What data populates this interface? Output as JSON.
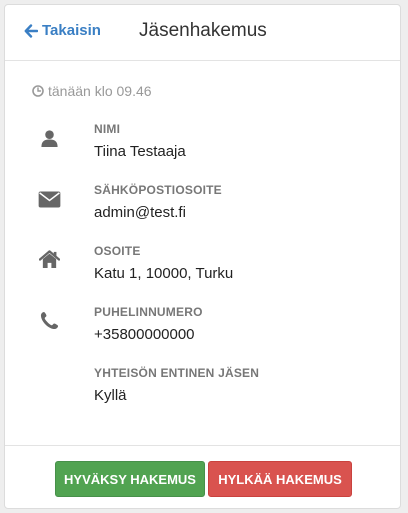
{
  "header": {
    "back_label": "Takaisin",
    "title": "Jäsenhakemus"
  },
  "timestamp": "tänään klo 09.46",
  "fields": [
    {
      "icon": "user-icon",
      "label": "NIMI",
      "value": "Tiina Testaaja"
    },
    {
      "icon": "envelope-icon",
      "label": "SÄHKÖPOSTIOSOITE",
      "value": "admin@test.fi"
    },
    {
      "icon": "home-icon",
      "label": "OSOITE",
      "value": "Katu 1, 10000, Turku"
    },
    {
      "icon": "phone-icon",
      "label": "PUHELINNUMERO",
      "value": "+35800000000"
    },
    {
      "icon": "",
      "label": "YHTEISÖN ENTINEN JÄSEN",
      "value": "Kyllä"
    }
  ],
  "actions": {
    "approve_label": "HYVÄKSY HAKEMUS",
    "reject_label": "HYLKÄÄ HAKEMUS"
  },
  "colors": {
    "link": "#3a7fc4",
    "approve": "#51a351",
    "reject": "#d9534f",
    "icon": "#666666"
  }
}
